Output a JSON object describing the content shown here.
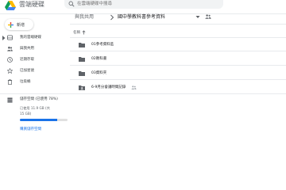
{
  "header": {
    "app_title": "雲端硬碟",
    "search_placeholder": "在雲端硬碟中搜尋"
  },
  "sidebar": {
    "new_label": "新增",
    "items": [
      {
        "label": "我的雲端硬碟",
        "icon": "drive-icon",
        "has_chevron": true
      },
      {
        "label": "與我共用",
        "icon": "people-icon"
      },
      {
        "label": "近期存取",
        "icon": "clock-icon"
      },
      {
        "label": "已加星號",
        "icon": "star-icon"
      },
      {
        "label": "垃圾桶",
        "icon": "trash-icon"
      }
    ],
    "storage": {
      "title": "儲存空間 (已使用 78%)",
      "used_text": "已使用 11.9 GB (共",
      "total_text": "15 GB)",
      "used_fraction": 0.78,
      "buy_label": "購買儲存空間"
    }
  },
  "breadcrumb": {
    "root": "與我共用",
    "current": "國中學教科書參考資料"
  },
  "list": {
    "column_name": "名稱",
    "rows": [
      {
        "name": "01參考資料區",
        "icon": "folder-icon",
        "shared": false
      },
      {
        "name": "02教科書",
        "icon": "folder-icon",
        "shared": false
      },
      {
        "name": "03資料夾",
        "icon": "folder-icon",
        "shared": false
      },
      {
        "name": "6-9月分會議時間記錄",
        "icon": "shared-folder-icon",
        "shared": true
      }
    ]
  },
  "colors": {
    "accent": "#1a73e8",
    "folder": "#5f6368",
    "divider": "#e8eaed"
  }
}
